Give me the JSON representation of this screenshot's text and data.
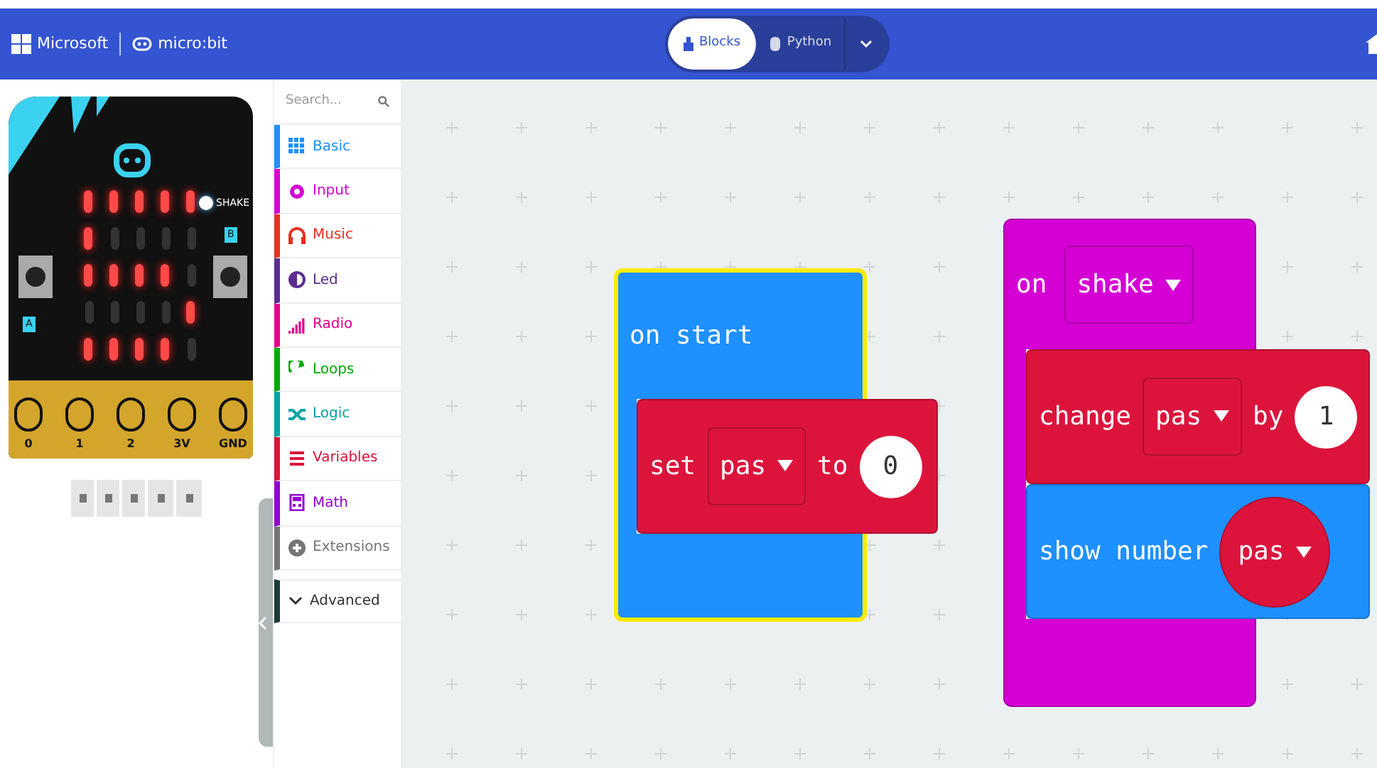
{
  "header": {
    "brand": "Microsoft",
    "product": "micro:bit",
    "editor_tabs": [
      {
        "label": "Blocks",
        "selected": true
      },
      {
        "label": "Python",
        "selected": false
      }
    ]
  },
  "simulator": {
    "leds": [
      [
        true,
        true,
        true,
        true,
        true
      ],
      [
        true,
        false,
        false,
        false,
        false
      ],
      [
        true,
        true,
        true,
        true,
        false
      ],
      [
        false,
        false,
        false,
        false,
        true
      ],
      [
        true,
        true,
        true,
        true,
        false
      ]
    ],
    "shake_label": "SHAKE",
    "button_a": "A",
    "button_b": "B",
    "pins": [
      "0",
      "1",
      "2",
      "3V",
      "GND"
    ]
  },
  "toolbox": {
    "search": {
      "placeholder": "Search..."
    },
    "categories": [
      {
        "label": "Basic",
        "color": "#1e90ff",
        "kind": "grid"
      },
      {
        "label": "Input",
        "color": "#d400d4",
        "kind": "circle"
      },
      {
        "label": "Music",
        "color": "#e63022",
        "kind": "headphones"
      },
      {
        "label": "Led",
        "color": "#5c2d91",
        "kind": "half"
      },
      {
        "label": "Radio",
        "color": "#e3008c",
        "kind": "signal"
      },
      {
        "label": "Loops",
        "color": "#00aa00",
        "kind": "loop"
      },
      {
        "label": "Logic",
        "color": "#00a4a6",
        "kind": "shuffle"
      },
      {
        "label": "Variables",
        "color": "#dc143c",
        "kind": "list"
      },
      {
        "label": "Math",
        "color": "#9400d3",
        "kind": "calc"
      },
      {
        "label": "Extensions",
        "color": "#757575",
        "kind": "plus"
      }
    ],
    "advanced": "Advanced"
  },
  "workspace": {
    "blocks": [
      {
        "kind": "start",
        "selected": true,
        "color": "#1e90ff",
        "hat": [
          {
            "kind": "word",
            "text": "on start"
          }
        ],
        "statements": [
          {
            "color": "#dc143c",
            "parts": [
              {
                "kind": "word",
                "text": "set"
              },
              {
                "kind": "dropdown",
                "text": "pas"
              },
              {
                "kind": "word",
                "text": "to"
              },
              {
                "kind": "number",
                "text": "0"
              }
            ]
          }
        ]
      },
      {
        "kind": "shake",
        "selected": false,
        "color": "#d400d4",
        "hat": [
          {
            "kind": "word",
            "text": "on"
          },
          {
            "kind": "dropdown",
            "text": "shake"
          }
        ],
        "statements": [
          {
            "color": "#dc143c",
            "parts": [
              {
                "kind": "word",
                "text": "change"
              },
              {
                "kind": "dropdown",
                "text": "pas"
              },
              {
                "kind": "word",
                "text": "by"
              },
              {
                "kind": "number",
                "text": "1"
              }
            ]
          },
          {
            "color": "#1e90ff",
            "parts": [
              {
                "kind": "word",
                "text": "show number"
              },
              {
                "kind": "reporter",
                "text": "pas"
              }
            ]
          }
        ]
      }
    ]
  }
}
